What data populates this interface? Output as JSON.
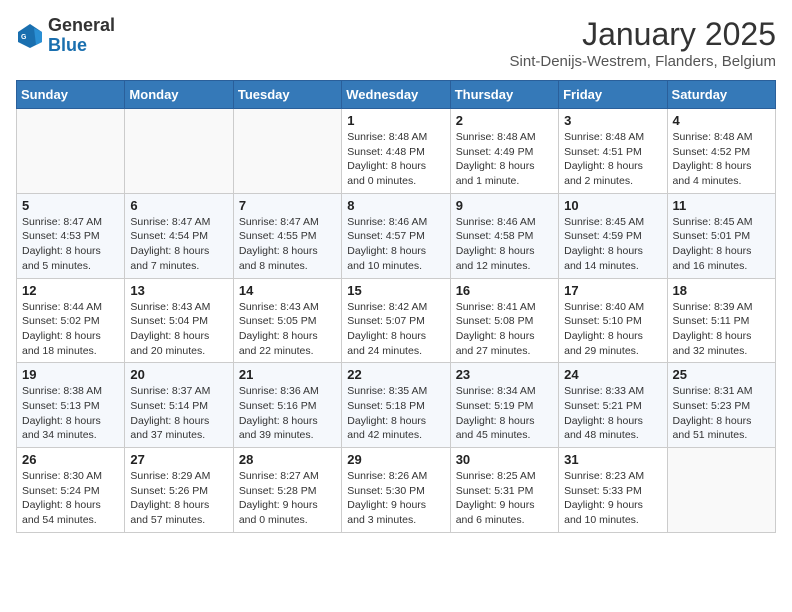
{
  "logo": {
    "general": "General",
    "blue": "Blue"
  },
  "header": {
    "month": "January 2025",
    "location": "Sint-Denijs-Westrem, Flanders, Belgium"
  },
  "weekdays": [
    "Sunday",
    "Monday",
    "Tuesday",
    "Wednesday",
    "Thursday",
    "Friday",
    "Saturday"
  ],
  "weeks": [
    [
      {
        "day": "",
        "info": ""
      },
      {
        "day": "",
        "info": ""
      },
      {
        "day": "",
        "info": ""
      },
      {
        "day": "1",
        "info": "Sunrise: 8:48 AM\nSunset: 4:48 PM\nDaylight: 8 hours\nand 0 minutes."
      },
      {
        "day": "2",
        "info": "Sunrise: 8:48 AM\nSunset: 4:49 PM\nDaylight: 8 hours\nand 1 minute."
      },
      {
        "day": "3",
        "info": "Sunrise: 8:48 AM\nSunset: 4:51 PM\nDaylight: 8 hours\nand 2 minutes."
      },
      {
        "day": "4",
        "info": "Sunrise: 8:48 AM\nSunset: 4:52 PM\nDaylight: 8 hours\nand 4 minutes."
      }
    ],
    [
      {
        "day": "5",
        "info": "Sunrise: 8:47 AM\nSunset: 4:53 PM\nDaylight: 8 hours\nand 5 minutes."
      },
      {
        "day": "6",
        "info": "Sunrise: 8:47 AM\nSunset: 4:54 PM\nDaylight: 8 hours\nand 7 minutes."
      },
      {
        "day": "7",
        "info": "Sunrise: 8:47 AM\nSunset: 4:55 PM\nDaylight: 8 hours\nand 8 minutes."
      },
      {
        "day": "8",
        "info": "Sunrise: 8:46 AM\nSunset: 4:57 PM\nDaylight: 8 hours\nand 10 minutes."
      },
      {
        "day": "9",
        "info": "Sunrise: 8:46 AM\nSunset: 4:58 PM\nDaylight: 8 hours\nand 12 minutes."
      },
      {
        "day": "10",
        "info": "Sunrise: 8:45 AM\nSunset: 4:59 PM\nDaylight: 8 hours\nand 14 minutes."
      },
      {
        "day": "11",
        "info": "Sunrise: 8:45 AM\nSunset: 5:01 PM\nDaylight: 8 hours\nand 16 minutes."
      }
    ],
    [
      {
        "day": "12",
        "info": "Sunrise: 8:44 AM\nSunset: 5:02 PM\nDaylight: 8 hours\nand 18 minutes."
      },
      {
        "day": "13",
        "info": "Sunrise: 8:43 AM\nSunset: 5:04 PM\nDaylight: 8 hours\nand 20 minutes."
      },
      {
        "day": "14",
        "info": "Sunrise: 8:43 AM\nSunset: 5:05 PM\nDaylight: 8 hours\nand 22 minutes."
      },
      {
        "day": "15",
        "info": "Sunrise: 8:42 AM\nSunset: 5:07 PM\nDaylight: 8 hours\nand 24 minutes."
      },
      {
        "day": "16",
        "info": "Sunrise: 8:41 AM\nSunset: 5:08 PM\nDaylight: 8 hours\nand 27 minutes."
      },
      {
        "day": "17",
        "info": "Sunrise: 8:40 AM\nSunset: 5:10 PM\nDaylight: 8 hours\nand 29 minutes."
      },
      {
        "day": "18",
        "info": "Sunrise: 8:39 AM\nSunset: 5:11 PM\nDaylight: 8 hours\nand 32 minutes."
      }
    ],
    [
      {
        "day": "19",
        "info": "Sunrise: 8:38 AM\nSunset: 5:13 PM\nDaylight: 8 hours\nand 34 minutes."
      },
      {
        "day": "20",
        "info": "Sunrise: 8:37 AM\nSunset: 5:14 PM\nDaylight: 8 hours\nand 37 minutes."
      },
      {
        "day": "21",
        "info": "Sunrise: 8:36 AM\nSunset: 5:16 PM\nDaylight: 8 hours\nand 39 minutes."
      },
      {
        "day": "22",
        "info": "Sunrise: 8:35 AM\nSunset: 5:18 PM\nDaylight: 8 hours\nand 42 minutes."
      },
      {
        "day": "23",
        "info": "Sunrise: 8:34 AM\nSunset: 5:19 PM\nDaylight: 8 hours\nand 45 minutes."
      },
      {
        "day": "24",
        "info": "Sunrise: 8:33 AM\nSunset: 5:21 PM\nDaylight: 8 hours\nand 48 minutes."
      },
      {
        "day": "25",
        "info": "Sunrise: 8:31 AM\nSunset: 5:23 PM\nDaylight: 8 hours\nand 51 minutes."
      }
    ],
    [
      {
        "day": "26",
        "info": "Sunrise: 8:30 AM\nSunset: 5:24 PM\nDaylight: 8 hours\nand 54 minutes."
      },
      {
        "day": "27",
        "info": "Sunrise: 8:29 AM\nSunset: 5:26 PM\nDaylight: 8 hours\nand 57 minutes."
      },
      {
        "day": "28",
        "info": "Sunrise: 8:27 AM\nSunset: 5:28 PM\nDaylight: 9 hours\nand 0 minutes."
      },
      {
        "day": "29",
        "info": "Sunrise: 8:26 AM\nSunset: 5:30 PM\nDaylight: 9 hours\nand 3 minutes."
      },
      {
        "day": "30",
        "info": "Sunrise: 8:25 AM\nSunset: 5:31 PM\nDaylight: 9 hours\nand 6 minutes."
      },
      {
        "day": "31",
        "info": "Sunrise: 8:23 AM\nSunset: 5:33 PM\nDaylight: 9 hours\nand 10 minutes."
      },
      {
        "day": "",
        "info": ""
      }
    ]
  ]
}
